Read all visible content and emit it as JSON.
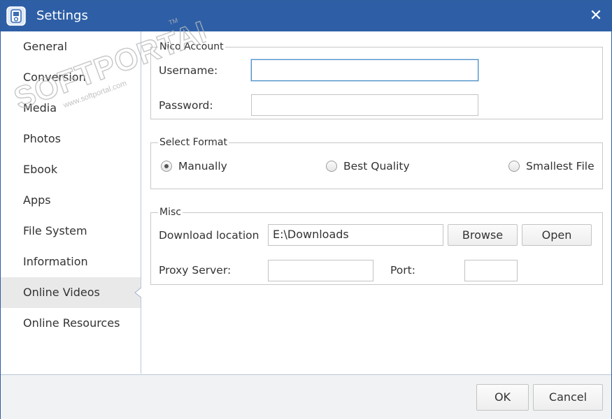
{
  "window": {
    "title": "Settings",
    "close_glyph": "✕"
  },
  "sidebar": {
    "items": [
      {
        "label": "General"
      },
      {
        "label": "Conversion"
      },
      {
        "label": "Media"
      },
      {
        "label": "Photos"
      },
      {
        "label": "Ebook"
      },
      {
        "label": "Apps"
      },
      {
        "label": "File System"
      },
      {
        "label": "Information"
      },
      {
        "label": "Online Videos",
        "active": true
      },
      {
        "label": "Online Resources"
      }
    ]
  },
  "nico_account": {
    "legend": "Nico Account",
    "username_label": "Username:",
    "username_value": "",
    "password_label": "Password:",
    "password_value": ""
  },
  "select_format": {
    "legend": "Select Format",
    "options": [
      {
        "label": "Manually",
        "checked": true
      },
      {
        "label": "Best Quality",
        "checked": false
      },
      {
        "label": "Smallest File",
        "checked": false
      }
    ]
  },
  "misc": {
    "legend": "Misc",
    "download_label": "Download location",
    "download_value": "E:\\Downloads",
    "browse_label": "Browse",
    "open_label": "Open",
    "proxy_label": "Proxy Server:",
    "proxy_value": "",
    "port_label": "Port:",
    "port_value": ""
  },
  "footer": {
    "ok_label": "OK",
    "cancel_label": "Cancel"
  },
  "watermark": {
    "text": "SOFTPORTAL",
    "url": "www.softportal.com",
    "tm": "TM"
  },
  "colors": {
    "titlebar": "#2e5fa6",
    "active_item": "#e9e9ea",
    "border": "#c8c8c8"
  }
}
